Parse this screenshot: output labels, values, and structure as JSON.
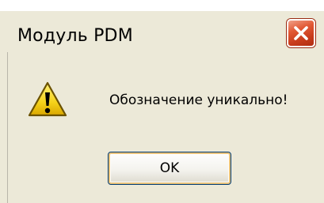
{
  "window": {
    "title": "Модуль PDM",
    "close_icon": "close-icon"
  },
  "dialog": {
    "icon": "warning-icon",
    "message": "Обозначение уникально!",
    "ok_label": "OK"
  },
  "colors": {
    "dialog_background": "#ece9d8",
    "close_button": "#e25a36",
    "warning_fill": "#f5d21a",
    "button_focus": "#e8c27a"
  }
}
